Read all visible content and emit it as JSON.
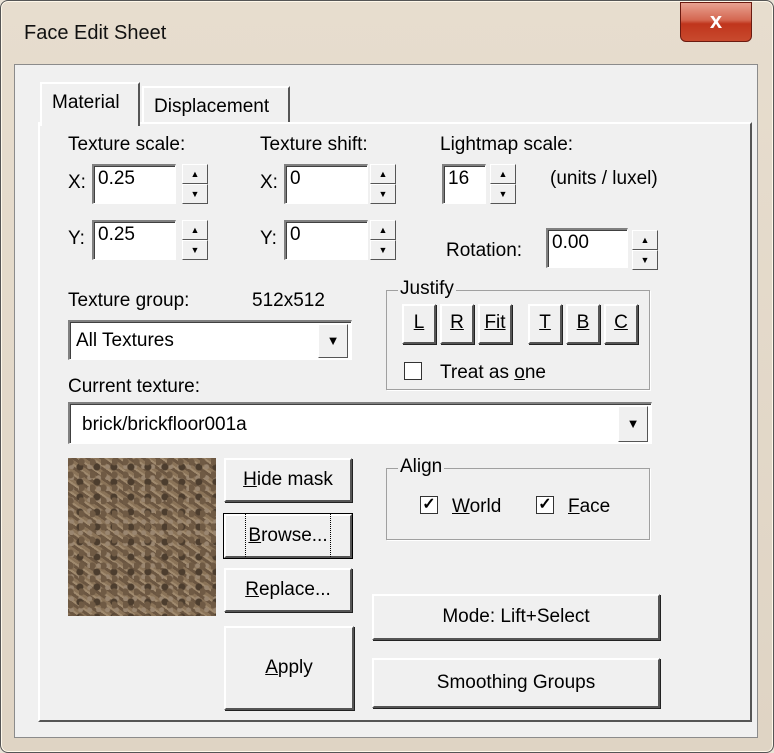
{
  "window": {
    "title": "Face Edit Sheet",
    "close_label": "x"
  },
  "tabs": [
    {
      "label": "Material"
    },
    {
      "label": "Displacement"
    }
  ],
  "texture_scale": {
    "label": "Texture scale:",
    "x_label": "X:",
    "x_value": "0.25",
    "y_label": "Y:",
    "y_value": "0.25"
  },
  "texture_shift": {
    "label": "Texture shift:",
    "x_label": "X:",
    "x_value": "0",
    "y_label": "Y:",
    "y_value": "0"
  },
  "lightmap": {
    "label": "Lightmap scale:",
    "value": "16",
    "units": "(units / luxel)"
  },
  "rotation": {
    "label": "Rotation:",
    "value": "0.00"
  },
  "texture_group": {
    "label": "Texture group:",
    "size": "512x512",
    "selected": "All Textures"
  },
  "justify": {
    "title": "Justify",
    "buttons": [
      "L",
      "R",
      "Fit",
      "T",
      "B",
      "C"
    ],
    "treat_as_one": {
      "label_pre": "Treat as ",
      "label_u": "o",
      "label_post": "ne",
      "checked": false
    }
  },
  "current_texture": {
    "label": "Current texture:",
    "value": "brick/brickfloor001a"
  },
  "buttons": {
    "hide_mask_u": "H",
    "hide_mask_rest": "ide mask",
    "browse_u": "B",
    "browse_rest": "rowse...",
    "replace_u": "R",
    "replace_rest": "eplace...",
    "apply_u": "A",
    "apply_rest": "pply",
    "mode": "Mode: Lift+Select",
    "smoothing": "Smoothing Groups"
  },
  "align": {
    "title": "Align",
    "world": {
      "label_u": "W",
      "label_rest": "orld",
      "checked": true
    },
    "face": {
      "label_u": "F",
      "label_rest": "ace",
      "checked": true
    }
  },
  "colors": {
    "close": "#c0351c",
    "panel": "#f0f0f0",
    "frame": "#e7ddce"
  }
}
